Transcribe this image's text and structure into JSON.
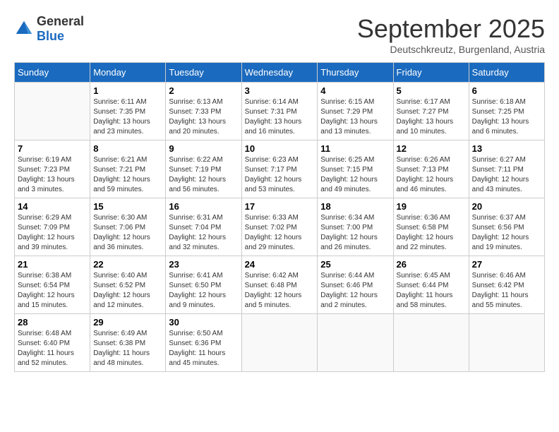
{
  "logo": {
    "general": "General",
    "blue": "Blue"
  },
  "title": "September 2025",
  "subtitle": "Deutschkreutz, Burgenland, Austria",
  "days_header": [
    "Sunday",
    "Monday",
    "Tuesday",
    "Wednesday",
    "Thursday",
    "Friday",
    "Saturday"
  ],
  "weeks": [
    [
      {
        "day": "",
        "content": ""
      },
      {
        "day": "1",
        "content": "Sunrise: 6:11 AM\nSunset: 7:35 PM\nDaylight: 13 hours\nand 23 minutes."
      },
      {
        "day": "2",
        "content": "Sunrise: 6:13 AM\nSunset: 7:33 PM\nDaylight: 13 hours\nand 20 minutes."
      },
      {
        "day": "3",
        "content": "Sunrise: 6:14 AM\nSunset: 7:31 PM\nDaylight: 13 hours\nand 16 minutes."
      },
      {
        "day": "4",
        "content": "Sunrise: 6:15 AM\nSunset: 7:29 PM\nDaylight: 13 hours\nand 13 minutes."
      },
      {
        "day": "5",
        "content": "Sunrise: 6:17 AM\nSunset: 7:27 PM\nDaylight: 13 hours\nand 10 minutes."
      },
      {
        "day": "6",
        "content": "Sunrise: 6:18 AM\nSunset: 7:25 PM\nDaylight: 13 hours\nand 6 minutes."
      }
    ],
    [
      {
        "day": "7",
        "content": "Sunrise: 6:19 AM\nSunset: 7:23 PM\nDaylight: 13 hours\nand 3 minutes."
      },
      {
        "day": "8",
        "content": "Sunrise: 6:21 AM\nSunset: 7:21 PM\nDaylight: 12 hours\nand 59 minutes."
      },
      {
        "day": "9",
        "content": "Sunrise: 6:22 AM\nSunset: 7:19 PM\nDaylight: 12 hours\nand 56 minutes."
      },
      {
        "day": "10",
        "content": "Sunrise: 6:23 AM\nSunset: 7:17 PM\nDaylight: 12 hours\nand 53 minutes."
      },
      {
        "day": "11",
        "content": "Sunrise: 6:25 AM\nSunset: 7:15 PM\nDaylight: 12 hours\nand 49 minutes."
      },
      {
        "day": "12",
        "content": "Sunrise: 6:26 AM\nSunset: 7:13 PM\nDaylight: 12 hours\nand 46 minutes."
      },
      {
        "day": "13",
        "content": "Sunrise: 6:27 AM\nSunset: 7:11 PM\nDaylight: 12 hours\nand 43 minutes."
      }
    ],
    [
      {
        "day": "14",
        "content": "Sunrise: 6:29 AM\nSunset: 7:09 PM\nDaylight: 12 hours\nand 39 minutes."
      },
      {
        "day": "15",
        "content": "Sunrise: 6:30 AM\nSunset: 7:06 PM\nDaylight: 12 hours\nand 36 minutes."
      },
      {
        "day": "16",
        "content": "Sunrise: 6:31 AM\nSunset: 7:04 PM\nDaylight: 12 hours\nand 32 minutes."
      },
      {
        "day": "17",
        "content": "Sunrise: 6:33 AM\nSunset: 7:02 PM\nDaylight: 12 hours\nand 29 minutes."
      },
      {
        "day": "18",
        "content": "Sunrise: 6:34 AM\nSunset: 7:00 PM\nDaylight: 12 hours\nand 26 minutes."
      },
      {
        "day": "19",
        "content": "Sunrise: 6:36 AM\nSunset: 6:58 PM\nDaylight: 12 hours\nand 22 minutes."
      },
      {
        "day": "20",
        "content": "Sunrise: 6:37 AM\nSunset: 6:56 PM\nDaylight: 12 hours\nand 19 minutes."
      }
    ],
    [
      {
        "day": "21",
        "content": "Sunrise: 6:38 AM\nSunset: 6:54 PM\nDaylight: 12 hours\nand 15 minutes."
      },
      {
        "day": "22",
        "content": "Sunrise: 6:40 AM\nSunset: 6:52 PM\nDaylight: 12 hours\nand 12 minutes."
      },
      {
        "day": "23",
        "content": "Sunrise: 6:41 AM\nSunset: 6:50 PM\nDaylight: 12 hours\nand 9 minutes."
      },
      {
        "day": "24",
        "content": "Sunrise: 6:42 AM\nSunset: 6:48 PM\nDaylight: 12 hours\nand 5 minutes."
      },
      {
        "day": "25",
        "content": "Sunrise: 6:44 AM\nSunset: 6:46 PM\nDaylight: 12 hours\nand 2 minutes."
      },
      {
        "day": "26",
        "content": "Sunrise: 6:45 AM\nSunset: 6:44 PM\nDaylight: 11 hours\nand 58 minutes."
      },
      {
        "day": "27",
        "content": "Sunrise: 6:46 AM\nSunset: 6:42 PM\nDaylight: 11 hours\nand 55 minutes."
      }
    ],
    [
      {
        "day": "28",
        "content": "Sunrise: 6:48 AM\nSunset: 6:40 PM\nDaylight: 11 hours\nand 52 minutes."
      },
      {
        "day": "29",
        "content": "Sunrise: 6:49 AM\nSunset: 6:38 PM\nDaylight: 11 hours\nand 48 minutes."
      },
      {
        "day": "30",
        "content": "Sunrise: 6:50 AM\nSunset: 6:36 PM\nDaylight: 11 hours\nand 45 minutes."
      },
      {
        "day": "",
        "content": ""
      },
      {
        "day": "",
        "content": ""
      },
      {
        "day": "",
        "content": ""
      },
      {
        "day": "",
        "content": ""
      }
    ]
  ]
}
